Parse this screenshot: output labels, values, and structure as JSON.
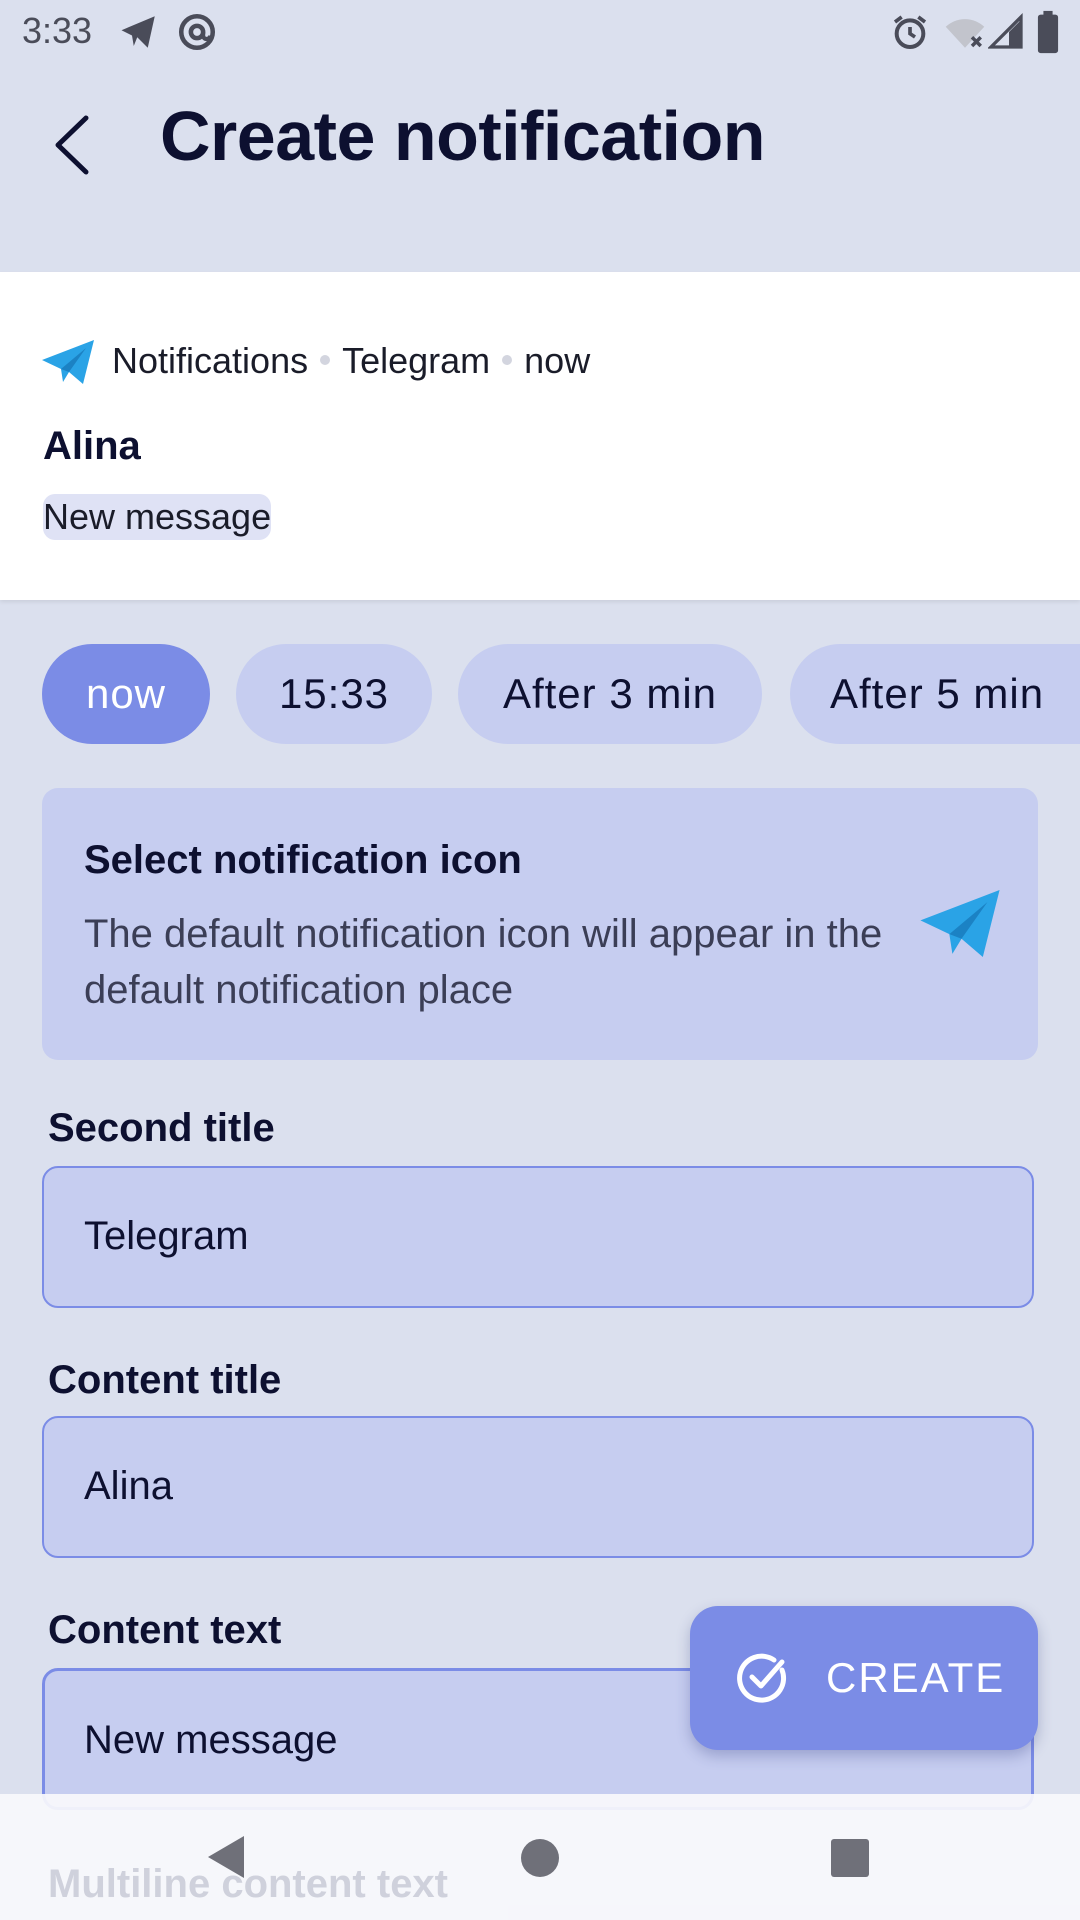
{
  "status_bar": {
    "time": "3:33",
    "left_icons": [
      "telegram-icon",
      "at-sign-icon"
    ],
    "right_icons": [
      "alarm-icon",
      "wifi-off-icon",
      "signal-icon",
      "battery-icon"
    ]
  },
  "app_bar": {
    "title": "Create notification",
    "back_icon": "chevron-left-icon"
  },
  "preview": {
    "app_name": "Notifications",
    "channel": "Telegram",
    "time": "now",
    "title": "Alina",
    "text": "New message"
  },
  "time_chips": [
    {
      "label": "now",
      "selected": true
    },
    {
      "label": "15:33",
      "selected": false
    },
    {
      "label": "After 3 min",
      "selected": false
    },
    {
      "label": "After 5 min",
      "selected": false
    }
  ],
  "icon_card": {
    "title": "Select notification icon",
    "description": "The default notification icon will appear in the default notification place",
    "icon": "telegram-icon"
  },
  "fields": {
    "second_title": {
      "label": "Second title",
      "value": "Telegram"
    },
    "content_title": {
      "label": "Content title",
      "value": "Alina"
    },
    "content_text": {
      "label": "Content text",
      "value": "New message"
    },
    "multiline_label": "Multiline content text"
  },
  "fab": {
    "label": "CREATE",
    "icon": "check-circle-icon"
  },
  "colors": {
    "background": "#dbe0ee",
    "accent": "#7b8ce6",
    "chip": "#c6cdf0",
    "telegram_blue": "#2aa3e6"
  }
}
